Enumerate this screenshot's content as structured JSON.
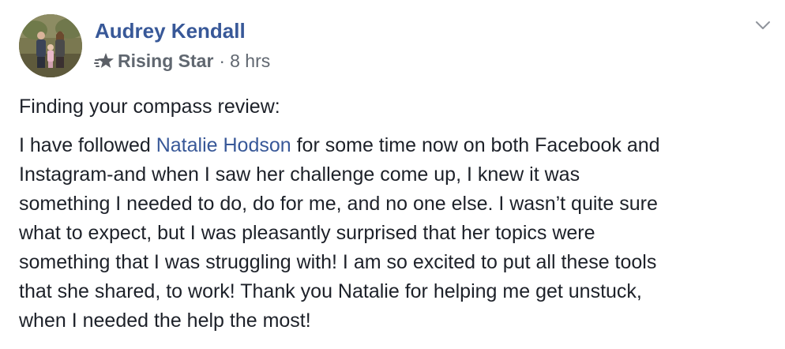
{
  "post": {
    "author": "Audrey Kendall",
    "badge": "Rising Star",
    "separator": "·",
    "time": "8 hrs",
    "paragraph_1": "Finding your compass review:",
    "paragraph_2": {
      "intro": "I have followed ",
      "mention": "Natalie Hodson",
      "line_1_rest": " for some time now on both Facebook and",
      "line_2": "Instagram-and when I saw her challenge come up, I knew it was",
      "line_3": "something I needed to do, do for me, and no one else. I wasn’t quite sure",
      "line_4": "what to expect, but I was pleasantly surprised that her topics were",
      "line_5": "something that I was struggling with! I am so excited to put all these tools",
      "line_6": "that she shared, to work! Thank you Natalie for helping me get unstuck,",
      "line_7": "when I needed the help the most!"
    }
  },
  "icons": {
    "avatar": "profile-photo",
    "badge": "rising-star-icon",
    "menu": "chevron-down-icon"
  },
  "colors": {
    "link": "#385898",
    "text": "#1d2129",
    "meta": "#606770"
  }
}
